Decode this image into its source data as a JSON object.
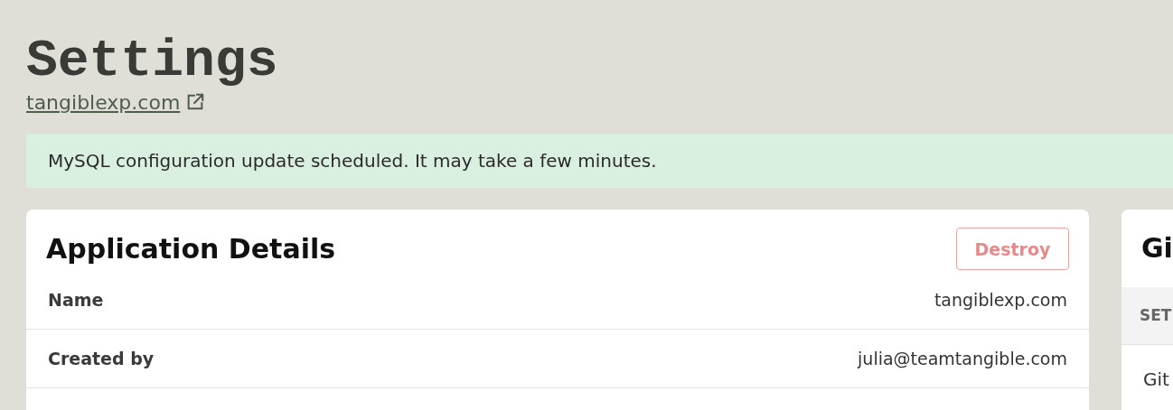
{
  "page": {
    "title": "Settings",
    "site_link": "tangiblexp.com"
  },
  "alert": {
    "message": "MySQL configuration update scheduled. It may take a few minutes."
  },
  "application_details": {
    "title": "Application Details",
    "destroy_button": "Destroy",
    "rows": [
      {
        "label": "Name",
        "value": "tangiblexp.com"
      },
      {
        "label": "Created by",
        "value": "julia@teamtangible.com"
      }
    ]
  },
  "side_card": {
    "title": "Gi",
    "section_header": "SET",
    "item": "Git"
  }
}
